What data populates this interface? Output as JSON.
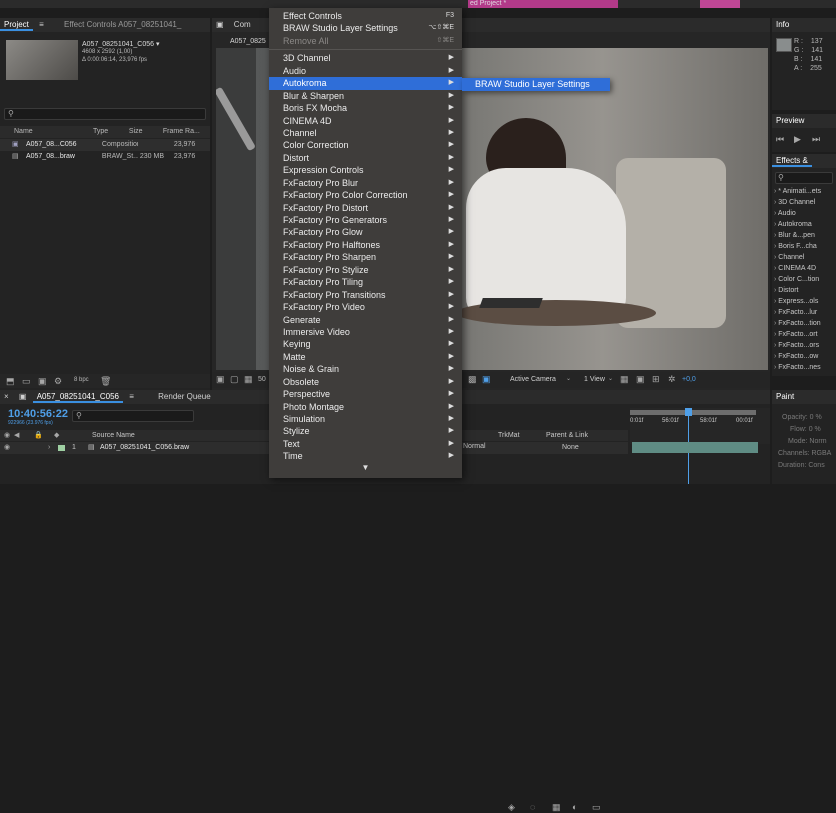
{
  "window": {
    "title_fragment": "ed Project *"
  },
  "project_panel": {
    "tab_label": "Project",
    "effect_controls_tab": "Effect Controls A057_08251041_",
    "comp_tab_short": "Com",
    "item_name": "A057_08251041_C056 ▾",
    "item_dims": "4608 x 2592 (1,00)",
    "item_duration": "Δ 0:00:06:14, 23,976 fps",
    "columns": [
      "Name",
      "Type",
      "Size",
      "Frame Ra..."
    ],
    "rows": [
      {
        "name": "A057_08...C056",
        "type": "Composition",
        "size": "",
        "fps": "23,976"
      },
      {
        "name": "A057_08...braw",
        "type": "BRAW_St...ter",
        "size": "230 MB",
        "fps": "23,976"
      }
    ],
    "bpc": "8 bpc"
  },
  "viewer": {
    "comp_tab": "A057_0825",
    "zoom": "50",
    "camera": "Active Camera",
    "view": "1 View",
    "exposure": "+0,0"
  },
  "menu": {
    "items": [
      {
        "label": "Effect Controls",
        "shortcut": "F3",
        "type": "shortcut"
      },
      {
        "label": "BRAW Studio Layer Settings",
        "shortcut": "⌥⇧⌘E",
        "type": "shortcut"
      },
      {
        "label": "Remove All",
        "shortcut": "⇧⌘E",
        "type": "disabled"
      },
      {
        "type": "separator"
      },
      {
        "label": "3D Channel",
        "type": "sub"
      },
      {
        "label": "Audio",
        "type": "sub"
      },
      {
        "label": "Autokroma",
        "type": "highlight"
      },
      {
        "label": "Blur & Sharpen",
        "type": "sub"
      },
      {
        "label": "Boris FX Mocha",
        "type": "sub"
      },
      {
        "label": "CINEMA 4D",
        "type": "sub"
      },
      {
        "label": "Channel",
        "type": "sub"
      },
      {
        "label": "Color Correction",
        "type": "sub"
      },
      {
        "label": "Distort",
        "type": "sub"
      },
      {
        "label": "Expression Controls",
        "type": "sub"
      },
      {
        "label": "FxFactory Pro Blur",
        "type": "sub"
      },
      {
        "label": "FxFactory Pro Color Correction",
        "type": "sub"
      },
      {
        "label": "FxFactory Pro Distort",
        "type": "sub"
      },
      {
        "label": "FxFactory Pro Generators",
        "type": "sub"
      },
      {
        "label": "FxFactory Pro Glow",
        "type": "sub"
      },
      {
        "label": "FxFactory Pro Halftones",
        "type": "sub"
      },
      {
        "label": "FxFactory Pro Sharpen",
        "type": "sub"
      },
      {
        "label": "FxFactory Pro Stylize",
        "type": "sub"
      },
      {
        "label": "FxFactory Pro Tiling",
        "type": "sub"
      },
      {
        "label": "FxFactory Pro Transitions",
        "type": "sub"
      },
      {
        "label": "FxFactory Pro Video",
        "type": "sub"
      },
      {
        "label": "Generate",
        "type": "sub"
      },
      {
        "label": "Immersive Video",
        "type": "sub"
      },
      {
        "label": "Keying",
        "type": "sub"
      },
      {
        "label": "Matte",
        "type": "sub"
      },
      {
        "label": "Noise & Grain",
        "type": "sub"
      },
      {
        "label": "Obsolete",
        "type": "sub"
      },
      {
        "label": "Perspective",
        "type": "sub"
      },
      {
        "label": "Photo Montage",
        "type": "sub"
      },
      {
        "label": "Simulation",
        "type": "sub"
      },
      {
        "label": "Stylize",
        "type": "sub"
      },
      {
        "label": "Text",
        "type": "sub"
      },
      {
        "label": "Time",
        "type": "sub"
      }
    ],
    "submenu_item": "BRAW Studio Layer Settings",
    "arrow_glyph": "▶",
    "scroll_glyph": "▼"
  },
  "info_panel": {
    "title": "Info",
    "values": [
      {
        "k": "R :",
        "v": "137"
      },
      {
        "k": "G :",
        "v": "141"
      },
      {
        "k": "B :",
        "v": "141"
      },
      {
        "k": "A :",
        "v": "255"
      }
    ]
  },
  "preview_panel": {
    "title": "Preview"
  },
  "effects_panel": {
    "title": "Effects &",
    "items": [
      "* Animati...ets",
      "3D Channel",
      "Audio",
      "Autokroma",
      "Blur &...pen",
      "Boris F...cha",
      "Channel",
      "CINEMA 4D",
      "Color C...tion",
      "Distort",
      "Express...ols",
      "FxFacto...lur",
      "FxFacto...tion",
      "FxFacto...ort",
      "FxFacto...ors",
      "FxFacto...ow",
      "FxFacto...nes"
    ]
  },
  "paint_panel": {
    "title": "Paint",
    "rows": [
      {
        "k": "Opacity:",
        "v": "0 %"
      },
      {
        "k": "Flow:",
        "v": "0 %"
      },
      {
        "k": "Mode:",
        "v": "Norm"
      },
      {
        "k": "Channels:",
        "v": "RGBA"
      },
      {
        "k": "Duration:",
        "v": "Cons"
      }
    ]
  },
  "timeline": {
    "comp_tab": "A057_08251041_C056",
    "render_queue": "Render Queue",
    "timecode": "10:40:56:22",
    "frame_info": "922966 (23.976 fps)",
    "column_source": "Source Name",
    "column_trkmat": "TrkMat",
    "column_parent": "Parent & Link",
    "layer_num": "1",
    "layer_name": "A057_08251041_C056.braw",
    "layer_mode": "Normal",
    "layer_parent": "None",
    "ruler": [
      "0:01f",
      "56:01f",
      "58:01f",
      "00:01f"
    ]
  }
}
